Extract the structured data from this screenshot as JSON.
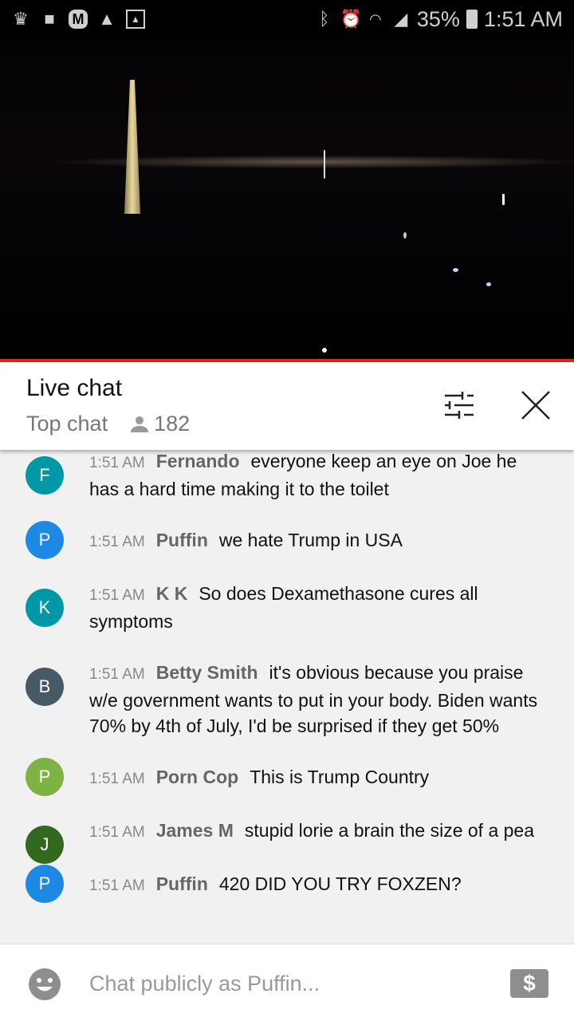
{
  "status_bar": {
    "battery": "35%",
    "time": "1:51 AM",
    "left_icons": [
      "crown-icon",
      "folder-icon",
      "m-app-icon",
      "warning-icon",
      "image-icon"
    ],
    "right_icons": [
      "bluetooth-icon",
      "alarm-icon",
      "wifi-icon",
      "signal-icon",
      "battery-icon"
    ]
  },
  "header": {
    "title": "Live chat",
    "mode": "Top chat",
    "viewers": "182"
  },
  "messages": [
    {
      "initial": "F",
      "color": "#0097a7",
      "time": "1:51 AM",
      "author": "Fernando",
      "text": "everyone keep an eye on Joe he has a hard time making it to the toilet"
    },
    {
      "initial": "P",
      "color": "#1e88e5",
      "time": "1:51 AM",
      "author": "Puffin",
      "text": "we hate Trump in USA"
    },
    {
      "initial": "K",
      "color": "#0097a7",
      "time": "1:51 AM",
      "author": "K K",
      "text": "So does Dexamethasone cures all symptoms"
    },
    {
      "initial": "B",
      "color": "#455a64",
      "time": "1:51 AM",
      "author": "Betty Smith",
      "text": "it's obvious because you praise w/e government wants to put in your body. Biden wants 70% by 4th of July, I'd be surprised if they get 50%"
    },
    {
      "initial": "P",
      "color": "#7cb342",
      "time": "1:51 AM",
      "author": "Porn Cop",
      "text": "This is Trump Country"
    },
    {
      "initial": "J",
      "color": "#33691e",
      "time": "1:51 AM",
      "author": "James M",
      "text": "stupid lorie a brain the size of a pea"
    },
    {
      "initial": "P",
      "color": "#1e88e5",
      "time": "1:51 AM",
      "author": "Puffin",
      "text": "420 DID YOU TRY FOXZEN?"
    }
  ],
  "footer": {
    "placeholder": "Chat publicly as Puffin...",
    "super_chat_label": "$"
  },
  "colors": {
    "progress": "#e62117",
    "background": "#f1f1f1"
  }
}
